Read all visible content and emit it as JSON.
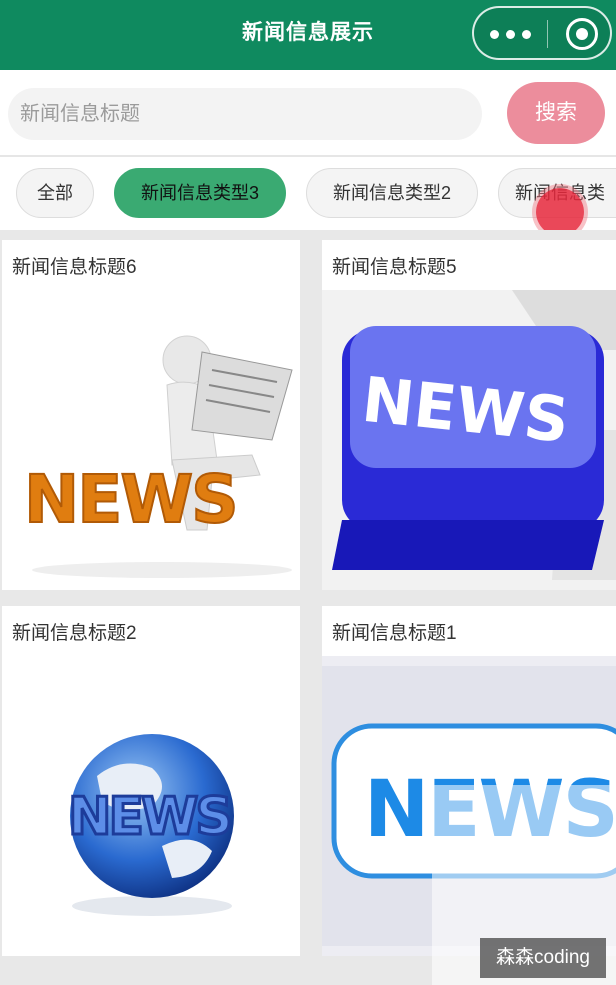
{
  "header": {
    "title": "新闻信息展示"
  },
  "search": {
    "placeholder": "新闻信息标题",
    "button_label": "搜索"
  },
  "categories": {
    "items": [
      {
        "label": "全部",
        "active": false
      },
      {
        "label": "新闻信息类型3",
        "active": true
      },
      {
        "label": "新闻信息类型2",
        "active": false
      },
      {
        "label": "新闻信息类",
        "active": false
      }
    ]
  },
  "news": [
    {
      "title": "新闻信息标题6",
      "image": "person-reading-newspaper-on-news-letters"
    },
    {
      "title": "新闻信息标题5",
      "image": "blue-news-keyboard-key"
    },
    {
      "title": "新闻信息标题2",
      "image": "news-globe"
    },
    {
      "title": "新闻信息标题1",
      "image": "blue-news-outlined-banner"
    }
  ],
  "watermark": "森森coding",
  "colors": {
    "navbar": "#0f8a5f",
    "active_chip": "#3aaa72",
    "search_button": "#ec8d9c"
  }
}
